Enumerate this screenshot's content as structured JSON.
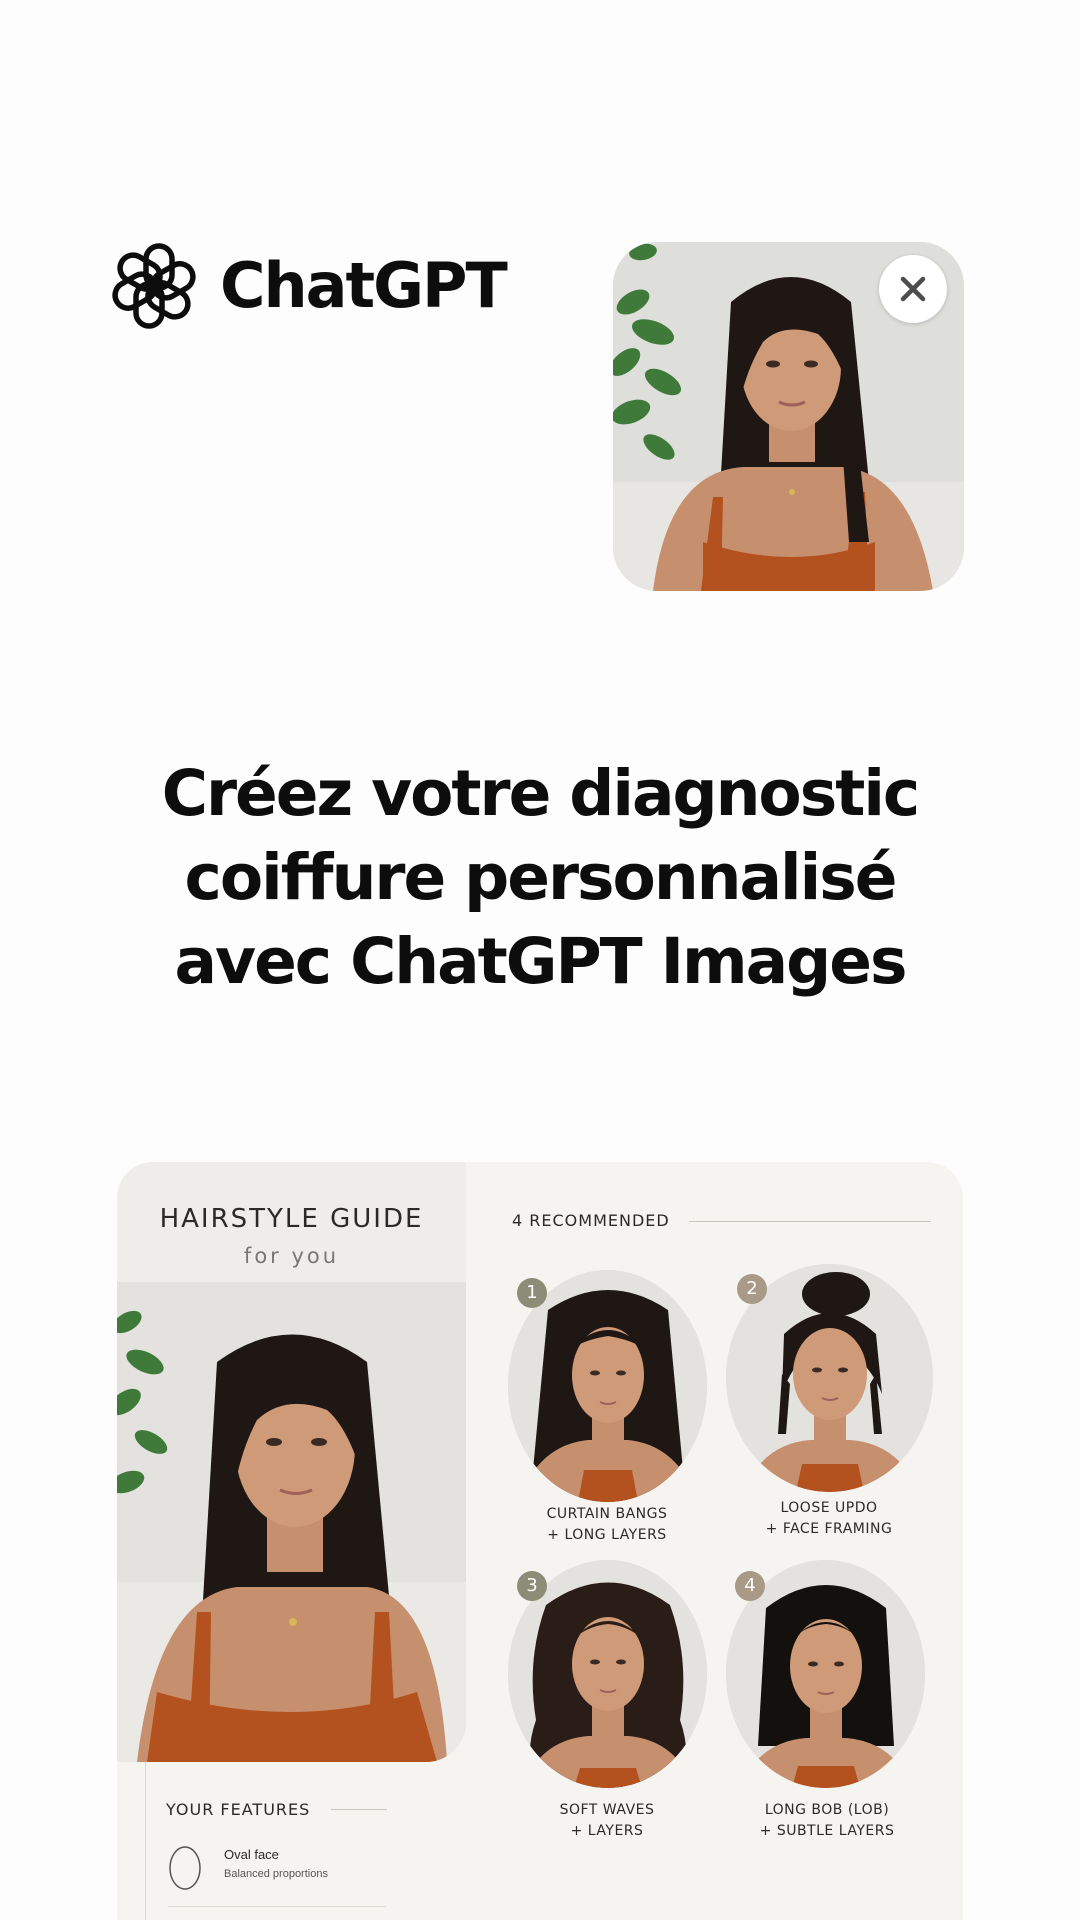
{
  "brand": {
    "name": "ChatGPT",
    "logo_icon": "openai-logo-icon"
  },
  "upload": {
    "thumb_icon": "photo-thumbnail",
    "close_icon": "close-icon"
  },
  "headline": {
    "line1": "Créez votre diagnostic",
    "line2": "coiffure personnalisé",
    "line3": "avec ChatGPT Images"
  },
  "card": {
    "guide_title": "HAIRSTYLE GUIDE",
    "guide_subtitle": "for you",
    "recommended_header": "4 RECOMMENDED",
    "styles": [
      {
        "number": "1",
        "line1": "CURTAIN BANGS",
        "line2": "+ LONG LAYERS"
      },
      {
        "number": "2",
        "line1": "LOOSE UPDO",
        "line2": "+ FACE FRAMING"
      },
      {
        "number": "3",
        "line1": "SOFT WAVES",
        "line2": "+ LAYERS"
      },
      {
        "number": "4",
        "line1": "LONG BOB (LOB)",
        "line2": "+ SUBTLE LAYERS"
      }
    ],
    "features_title": "YOUR FEATURES",
    "features": [
      {
        "name": "Oval face",
        "desc": "Balanced proportions",
        "icon": "oval-face-icon"
      }
    ]
  },
  "colors": {
    "text": "#0d0d0d",
    "card_bg": "#f6f4f1",
    "badge_green": "#8c8d76",
    "badge_tan": "#a89a86",
    "top_color": "#c45a2c"
  }
}
